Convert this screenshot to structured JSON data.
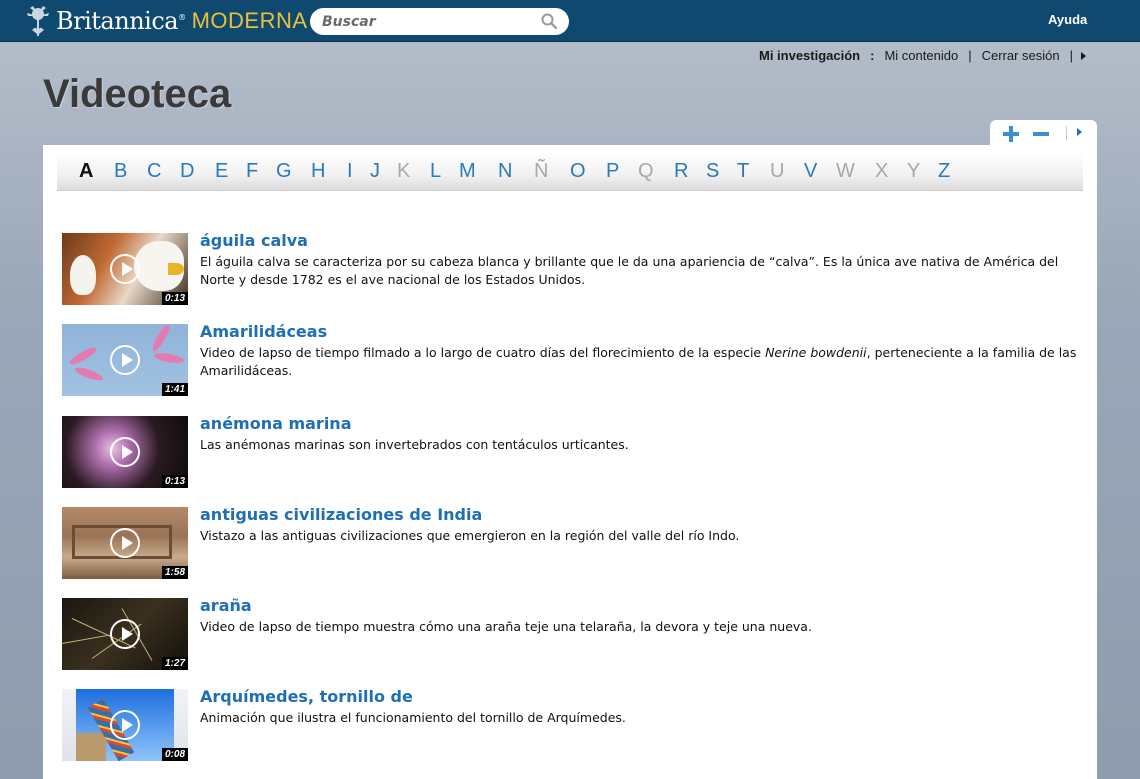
{
  "header": {
    "logo_brand": "Britannica",
    "logo_reg": "®",
    "logo_edition": "MODERNA",
    "search_placeholder": "Buscar",
    "help_label": "Ayuda"
  },
  "usernav": {
    "research_label": "Mi investigación",
    "colon": ":",
    "my_content": "Mi contenido",
    "sep": "|",
    "logout": "Cerrar sesión"
  },
  "page": {
    "title": "Videoteca"
  },
  "alphabet": {
    "active": "A",
    "letters": [
      {
        "letter": "A",
        "state": "active"
      },
      {
        "letter": "B",
        "state": "enabled"
      },
      {
        "letter": "C",
        "state": "enabled"
      },
      {
        "letter": "D",
        "state": "enabled"
      },
      {
        "letter": "E",
        "state": "enabled"
      },
      {
        "letter": "F",
        "state": "enabled"
      },
      {
        "letter": "G",
        "state": "enabled"
      },
      {
        "letter": "H",
        "state": "enabled"
      },
      {
        "letter": "I",
        "state": "enabled"
      },
      {
        "letter": "J",
        "state": "enabled"
      },
      {
        "letter": "K",
        "state": "disabled"
      },
      {
        "letter": "L",
        "state": "enabled"
      },
      {
        "letter": "M",
        "state": "enabled"
      },
      {
        "letter": "N",
        "state": "enabled"
      },
      {
        "letter": "Ñ",
        "state": "disabled"
      },
      {
        "letter": "O",
        "state": "enabled"
      },
      {
        "letter": "P",
        "state": "enabled"
      },
      {
        "letter": "Q",
        "state": "disabled"
      },
      {
        "letter": "R",
        "state": "enabled"
      },
      {
        "letter": "S",
        "state": "enabled"
      },
      {
        "letter": "T",
        "state": "enabled"
      },
      {
        "letter": "U",
        "state": "disabled"
      },
      {
        "letter": "V",
        "state": "enabled"
      },
      {
        "letter": "W",
        "state": "disabled"
      },
      {
        "letter": "X",
        "state": "disabled"
      },
      {
        "letter": "Y",
        "state": "disabled"
      },
      {
        "letter": "Z",
        "state": "enabled"
      }
    ]
  },
  "videos": [
    {
      "title": "águila calva",
      "duration": "0:13",
      "description": "El águila calva se caracteriza por su cabeza blanca y brillante que le da una apariencia de “calva”. Es la única ave nativa de América del Norte y desde 1782 es el ave nacional de los Estados Unidos."
    },
    {
      "title": "Amarilidáceas",
      "duration": "1:41",
      "description_before": "Video de lapso de tiempo filmado a lo largo de cuatro días del florecimiento de la especie ",
      "description_italic": "Nerine bowdenii",
      "description_after": ", perteneciente a la familia de las Amarilidáceas."
    },
    {
      "title": "anémona marina",
      "duration": "0:13",
      "description": "Las anémonas marinas son invertebrados con tentáculos urticantes."
    },
    {
      "title": "antiguas civilizaciones de India",
      "duration": "1:58",
      "description": "Vistazo a las antiguas civilizaciones que emergieron en la región del valle del río Indo."
    },
    {
      "title": "araña",
      "duration": "1:27",
      "description": "Video de lapso de tiempo muestra cómo una araña teje una telaraña, la devora y teje una nueva."
    },
    {
      "title": "Arquímedes, tornillo de",
      "duration": "0:08",
      "description": "Animación que ilustra el funcionamiento del tornillo de Arquímedes."
    }
  ],
  "colors": {
    "header_bg": "#0f4970",
    "link_blue": "#1f6fb5",
    "edition_gold": "#e7c23a",
    "disabled_letter": "#a8a8a8"
  },
  "icons": {
    "search": "search-icon",
    "play": "play-icon",
    "expand": "plus-icon",
    "collapse": "minus-icon",
    "next": "caret-right-icon"
  }
}
